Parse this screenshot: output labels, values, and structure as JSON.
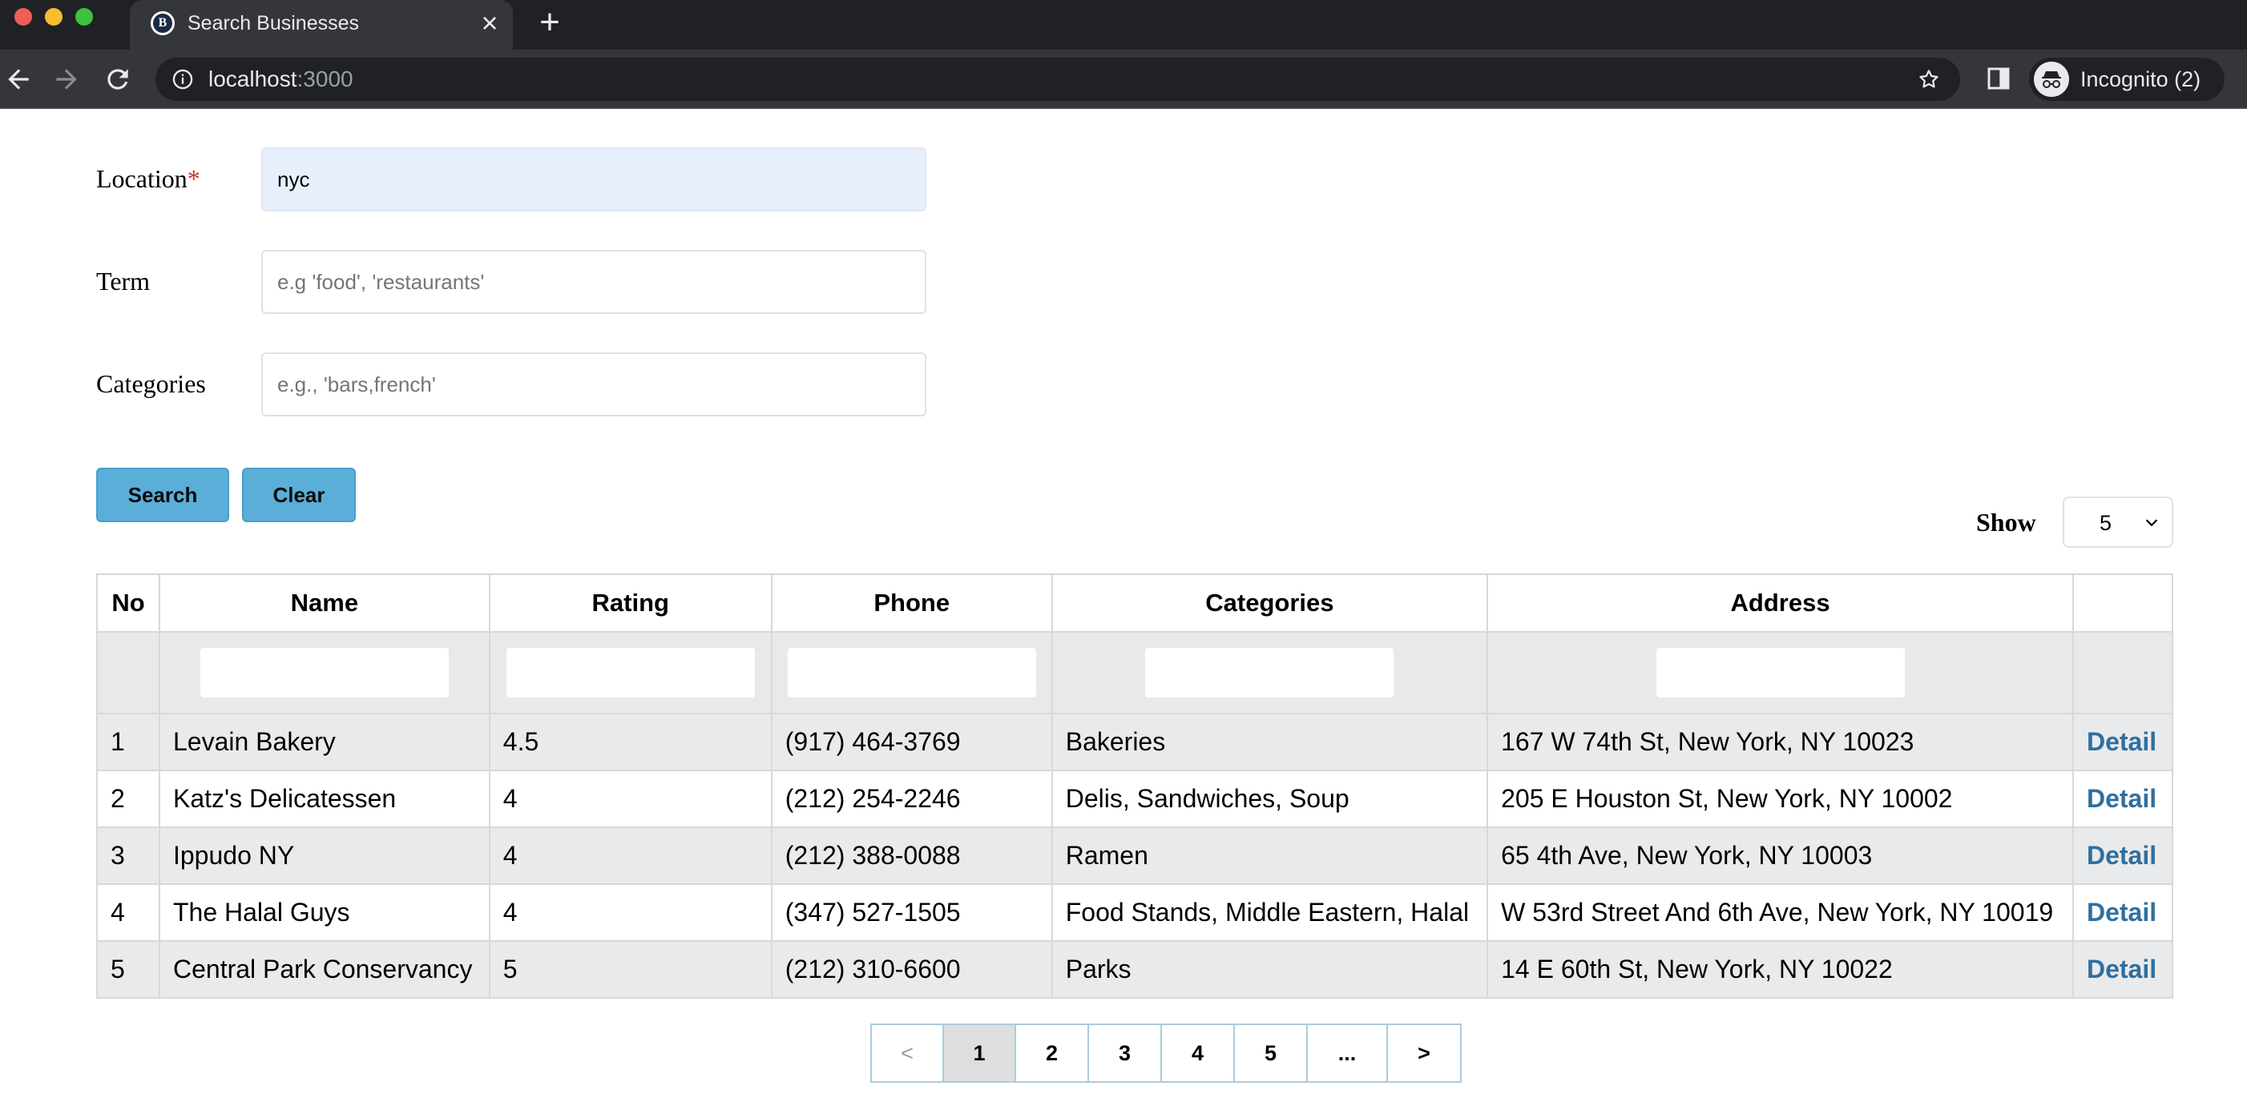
{
  "browser": {
    "tab_title": "Search Businesses",
    "tab_favicon_letter": "B",
    "url_host": "localhost",
    "url_port": ":3000",
    "profile_label": "Incognito (2)"
  },
  "form": {
    "location": {
      "label": "Location",
      "required_mark": "*",
      "value": "nyc"
    },
    "term": {
      "label": "Term",
      "placeholder": "e.g 'food', 'restaurants'"
    },
    "categories": {
      "label": "Categories",
      "placeholder": "e.g., 'bars,french'"
    },
    "search_button": "Search",
    "clear_button": "Clear"
  },
  "show": {
    "label": "Show",
    "selected": "5"
  },
  "table": {
    "headers": [
      "No",
      "Name",
      "Rating",
      "Phone",
      "Categories",
      "Address",
      ""
    ],
    "detail_label": "Detail",
    "rows": [
      {
        "no": "1",
        "name": "Levain Bakery",
        "rating": "4.5",
        "phone": "(917) 464-3769",
        "categories": "Bakeries",
        "address": "167 W 74th St, New York, NY 10023"
      },
      {
        "no": "2",
        "name": "Katz's Delicatessen",
        "rating": "4",
        "phone": "(212) 254-2246",
        "categories": "Delis, Sandwiches, Soup",
        "address": "205 E Houston St, New York, NY 10002"
      },
      {
        "no": "3",
        "name": "Ippudo NY",
        "rating": "4",
        "phone": "(212) 388-0088",
        "categories": "Ramen",
        "address": "65 4th Ave, New York, NY 10003"
      },
      {
        "no": "4",
        "name": "The Halal Guys",
        "rating": "4",
        "phone": "(347) 527-1505",
        "categories": "Food Stands, Middle Eastern, Halal",
        "address": "W 53rd Street And 6th Ave, New York, NY 10019"
      },
      {
        "no": "5",
        "name": "Central Park Conservancy",
        "rating": "5",
        "phone": "(212) 310-6600",
        "categories": "Parks",
        "address": "14 E 60th St, New York, NY 10022"
      }
    ]
  },
  "pagination": {
    "prev": "<",
    "pages": [
      "1",
      "2",
      "3",
      "4",
      "5"
    ],
    "ellipsis": "...",
    "next": ">",
    "current": "1"
  },
  "colors": {
    "button_bg": "#5aaed8",
    "detail_link": "#2f6f9f",
    "required_asterisk": "#d32f2f",
    "autofill_bg": "#e8f0fe"
  }
}
